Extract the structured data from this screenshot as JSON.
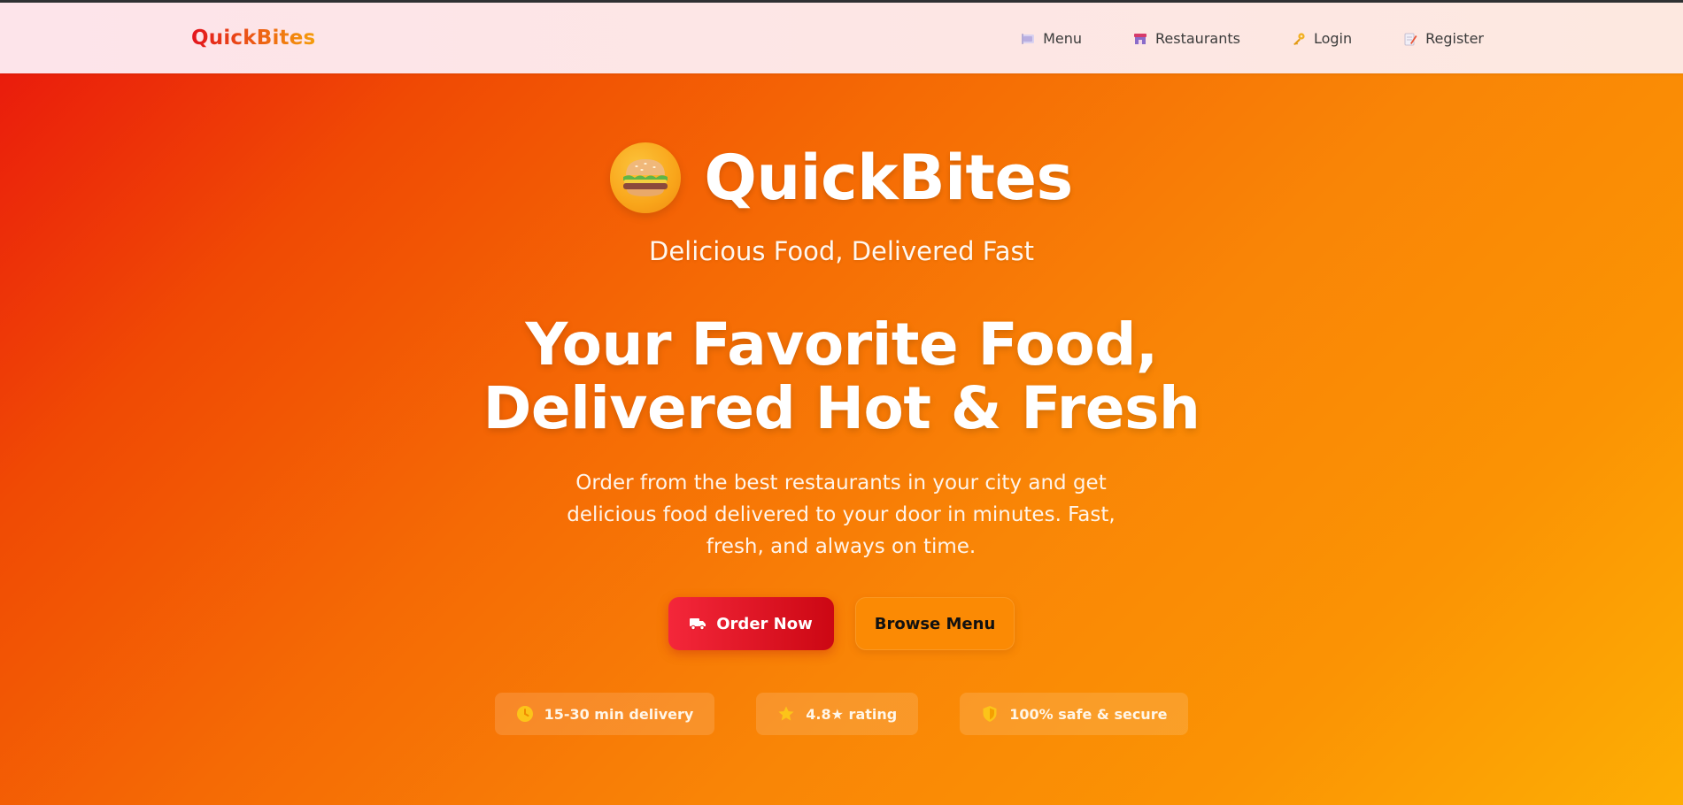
{
  "navbar": {
    "brand": "QuickBites",
    "links": [
      {
        "label": "Menu",
        "icon": "menu-plate-icon"
      },
      {
        "label": "Restaurants",
        "icon": "restaurant-icon"
      },
      {
        "label": "Login",
        "icon": "key-icon"
      },
      {
        "label": "Register",
        "icon": "memo-icon"
      }
    ]
  },
  "hero": {
    "logo_icon": "burger-icon",
    "title": "QuickBites",
    "tagline": "Delicious Food, Delivered Fast",
    "headline_line1": "Your Favorite Food,",
    "headline_line2": "Delivered Hot & Fresh",
    "description": "Order from the best restaurants in your city and get delicious food delivered to your door in minutes. Fast, fresh, and always on time.",
    "primary_button": {
      "label": "Order Now",
      "icon": "truck-icon"
    },
    "secondary_button": {
      "label": "Browse Menu"
    },
    "badges": [
      {
        "label": "15-30 min delivery",
        "icon": "clock-icon"
      },
      {
        "label": "4.8★ rating",
        "icon": "star-icon"
      },
      {
        "label": "100% safe & secure",
        "icon": "shield-icon"
      }
    ]
  },
  "colors": {
    "brand_red": "#e3141e",
    "brand_orange": "#f59e0b",
    "hero_gradient_start": "#ea1c0c",
    "hero_gradient_end": "#fdae04",
    "primary_button": "#e0101e",
    "badge_icon": "#fcc419"
  }
}
